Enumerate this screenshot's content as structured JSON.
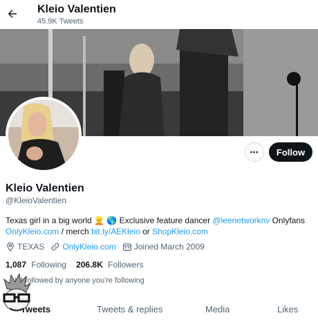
{
  "header": {
    "title": "Kleio Valentien",
    "subtitle": "45.9K Tweets"
  },
  "actions": {
    "more_label": "•••",
    "follow_label": "Follow"
  },
  "profile": {
    "name": "Kleio Valentien",
    "handle": "@KleioValentien",
    "bio": {
      "text1": "Texas girl in a big world",
      "emoji1": "👱",
      "emoji2": "🌎",
      "text2": "Exclusive feature dancer",
      "mention": "@leenetworknv",
      "text3": "Onlyfans",
      "link1": "OnlyKleio.com",
      "text4": "/ merch",
      "link2": "bit.ly/AEKleio",
      "text5": "or",
      "link3": "ShopKleio.com"
    },
    "location": "TEXAS",
    "website": "OnlyKleio.com",
    "joined": "Joined March 2009",
    "following_count": "1,087",
    "following_label": "Following",
    "followers_count": "206.8K",
    "followers_label": "Followers",
    "followed_note": "Not followed by anyone you're following"
  },
  "tabs": [
    {
      "label": "Tweets"
    },
    {
      "label": "Tweets & replies"
    },
    {
      "label": "Media"
    },
    {
      "label": "Likes"
    }
  ],
  "colors": {
    "accent": "#1d9bf0",
    "text": "#0f1419",
    "muted": "#536471",
    "follow_bg": "#0f1419"
  },
  "icons": {
    "back": "arrow-left-icon",
    "location": "location-pin-icon",
    "website": "link-icon",
    "joined": "calendar-icon"
  }
}
